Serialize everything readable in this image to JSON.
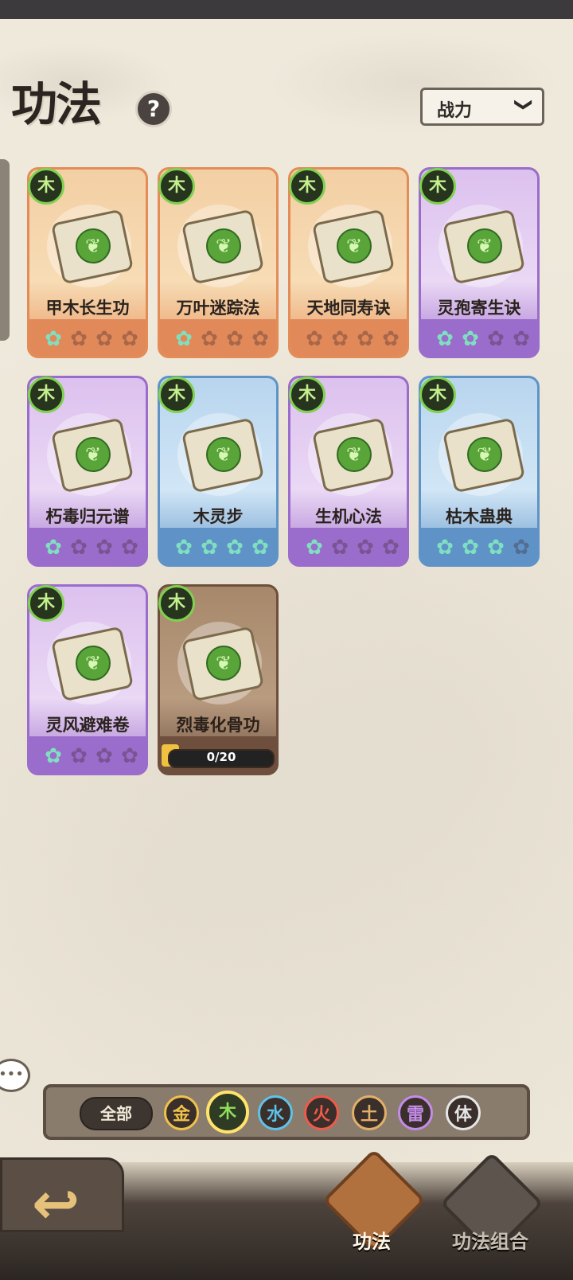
{
  "header": {
    "title": "功法",
    "help_icon": "?",
    "sort_label": "战力",
    "sort_chevron": "❯"
  },
  "cards": [
    {
      "name": "甲木长生功",
      "element": "木",
      "rarity": "orange",
      "stars_lit": 1,
      "stars_total": 4
    },
    {
      "name": "万叶迷踪法",
      "element": "木",
      "rarity": "orange",
      "stars_lit": 1,
      "stars_total": 4
    },
    {
      "name": "天地同寿诀",
      "element": "木",
      "rarity": "orange",
      "stars_lit": 0,
      "stars_total": 4
    },
    {
      "name": "灵孢寄生诀",
      "element": "木",
      "rarity": "purple",
      "stars_lit": 2,
      "stars_total": 4
    },
    {
      "name": "朽毒归元谱",
      "element": "木",
      "rarity": "purple",
      "stars_lit": 1,
      "stars_total": 4
    },
    {
      "name": "木灵步",
      "element": "木",
      "rarity": "blue",
      "stars_lit": 4,
      "stars_total": 4
    },
    {
      "name": "生机心法",
      "element": "木",
      "rarity": "purple",
      "stars_lit": 1,
      "stars_total": 4
    },
    {
      "name": "枯木蛊典",
      "element": "木",
      "rarity": "blue",
      "stars_lit": 3,
      "stars_total": 4
    },
    {
      "name": "灵风避难卷",
      "element": "木",
      "rarity": "purple",
      "stars_lit": 1,
      "stars_total": 4
    },
    {
      "name": "烈毒化骨功",
      "element": "木",
      "rarity": "brown",
      "locked": true,
      "progress_text": "0/20",
      "progress_fraction": 0
    }
  ],
  "filters": {
    "all_label": "全部",
    "elements": [
      {
        "label": "金",
        "color": "#f0c24a",
        "selected": false
      },
      {
        "label": "木",
        "color": "#8fe05a",
        "selected": true
      },
      {
        "label": "水",
        "color": "#5fc2e8",
        "selected": false
      },
      {
        "label": "火",
        "color": "#ef5a4a",
        "selected": false
      },
      {
        "label": "土",
        "color": "#e3b06a",
        "selected": false
      },
      {
        "label": "雷",
        "color": "#c48be8",
        "selected": false
      },
      {
        "label": "体",
        "color": "#e6e6e6",
        "selected": false
      }
    ]
  },
  "bottom_tabs": {
    "tab1_label": "功法",
    "tab2_label": "功法组合"
  },
  "colors": {
    "star_lit": "#7fe0c0",
    "element_badge": "#7fd14f"
  }
}
